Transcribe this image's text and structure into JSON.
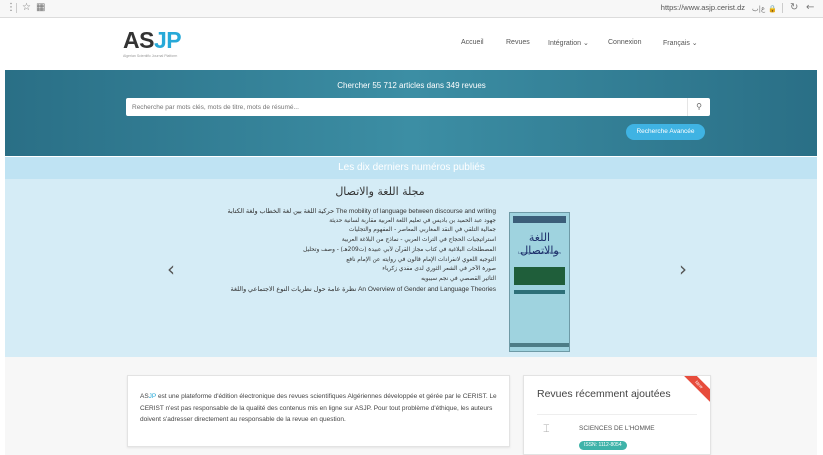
{
  "browser": {
    "menu_icon": "⋮",
    "star_icon": "☆",
    "ext_icon": "▦",
    "url": "https://www.asjp.cerist.dz",
    "lang_icon": "ع|ب",
    "lock_icon": "🔒",
    "refresh_icon": "↻",
    "back_icon": "←"
  },
  "header": {
    "logo_as": "AS",
    "logo_jp": "JP",
    "logo_tagline": "Algerian Scientific Journal Platform",
    "nav": [
      "Accueil",
      "Revues",
      "Intégration ⌄",
      "Connexion",
      "Français ⌄"
    ]
  },
  "search": {
    "title": "Chercher 55 712 articles dans 349 revues",
    "placeholder": "Recherche par mots clés, mots de titre, mots de résumé...",
    "button_icon": "⚲",
    "advanced_label": "Recherche Avancée"
  },
  "issues": {
    "section_title": "Les dix derniers numéros publiés",
    "prev_icon": "‹",
    "next_icon": "›",
    "journal_title": "مجلة اللغة والاتصال",
    "articles": [
      {
        "text": "The mobility of language between discourse and writing حركية اللغة بين لغة الخطاب ولغة الكتابة",
        "latin": true
      },
      {
        "text": "جهود عبد الحميد بن باديس في تعليم اللغة العربية مقاربة لسانية حديثة",
        "latin": false
      },
      {
        "text": "جمالية التلقي في النقد المغاربي المعاصر - المفهوم والتجليات",
        "latin": false
      },
      {
        "text": "استراتيجيات الحجاج في التراث العربي - نماذج من البلاغة العربية",
        "latin": false
      },
      {
        "text": "المصطلحات البلاغية في كتاب مجاز القرآن لأبي عبيدة (ت209هـ) - وصف وتحليل",
        "latin": false
      },
      {
        "text": "التوجيه اللغوي لانفرادات الإمام قالون في روايته عن الإمام نافع",
        "latin": false
      },
      {
        "text": "صورة الآخر في الشعر الثوري لدى مفدي زكرياء",
        "latin": false
      },
      {
        "text": "التأثير القصصي في نجم سيبويه",
        "latin": false
      },
      {
        "text": "An Overview of Gender and Language Theories نظرة عامة حول نظريات النوع الاجتماعي واللغة",
        "latin": true
      }
    ],
    "cover_title": "اللغة والاتصال",
    "cover_subtitle": "Langage & Communication"
  },
  "about": {
    "prefix_as": "AS",
    "prefix_jp": "JP",
    "text": " est une plateforme d'édition électronique des revues scientifiques Algériennes développée et gérée par le CERIST. Le CERIST n'est pas responsable de la qualité des contenus mis en ligne sur ASJP. Pour tout problème d'éthique, les auteurs doivent s'adresser directement au responsable de la revue en question."
  },
  "recent": {
    "title": "Revues récemment ajoutées",
    "ribbon": "New",
    "item_icon": "⌶",
    "item_name": "SCIENCES DE L'HOMME",
    "item_issn": "ISSN: 1112-8054"
  },
  "colors": {
    "accent": "#27a9d8",
    "band": "#3c8ea4",
    "issues_bg": "#d5ecf6",
    "ribbon": "#e74c3c",
    "issn": "#3fb3a9"
  }
}
